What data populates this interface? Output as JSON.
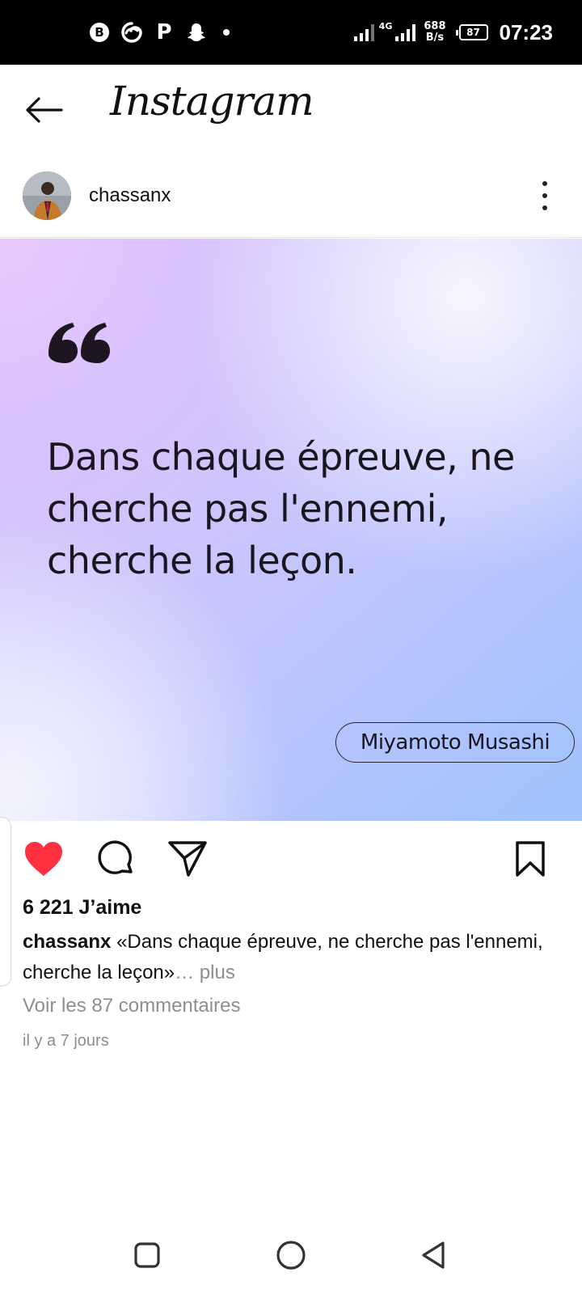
{
  "status_bar": {
    "app_icons": [
      "b-circle-icon",
      "swirl-app-icon",
      "p-app-icon",
      "snapchat-ghost-icon"
    ],
    "network": "4G",
    "speed_value": "688",
    "speed_unit": "B/s",
    "battery": "87",
    "time": "07:23"
  },
  "header": {
    "brand": "Instagram"
  },
  "post": {
    "username": "chassanx",
    "quote_lines": [
      "Dans chaque épreuve, ne",
      "cherche pas l'ennemi,",
      "cherche la leçon."
    ],
    "author": "Miyamoto Musashi",
    "liked": true,
    "likes_text": "6 221 J’aime",
    "caption_user": "chassanx",
    "caption_text": " «Dans chaque épreuve, ne cherche pas l'ennemi, cherche la leçon»",
    "caption_more": "… plus",
    "comments_link": "Voir les 87 commentaires",
    "timestamp": "il y a 7 jours"
  },
  "colors": {
    "like_red": "#ff3040",
    "text": "#111111",
    "muted": "#8e8e8e"
  }
}
